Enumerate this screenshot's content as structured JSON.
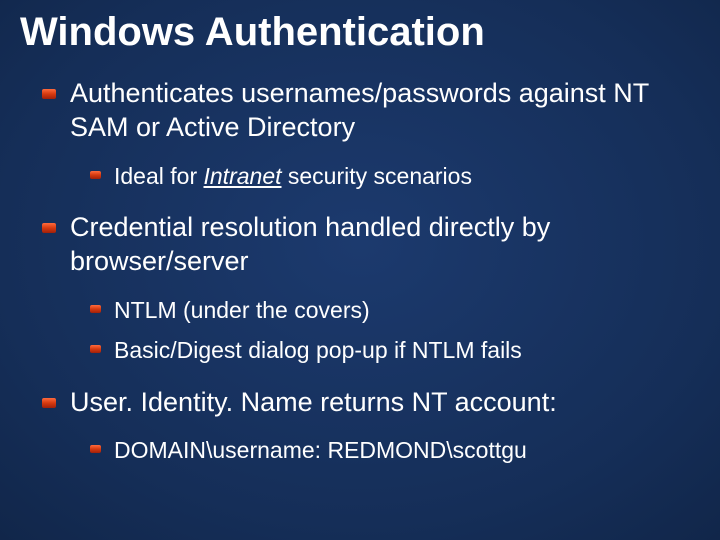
{
  "title": "Windows Authentication",
  "bullets": {
    "b1": {
      "text": "Authenticates usernames/passwords against NT SAM or Active Directory",
      "sub": {
        "s1_pre": "Ideal for ",
        "s1_em": "Intranet",
        "s1_post": " security scenarios"
      }
    },
    "b2": {
      "text": "Credential resolution handled directly by browser/server",
      "sub": {
        "s1": "NTLM (under the covers)",
        "s2": "Basic/Digest dialog pop-up if NTLM fails"
      }
    },
    "b3": {
      "text": "User. Identity. Name returns NT account:",
      "sub": {
        "s1": "DOMAIN\\username: REDMOND\\scottgu"
      }
    }
  }
}
